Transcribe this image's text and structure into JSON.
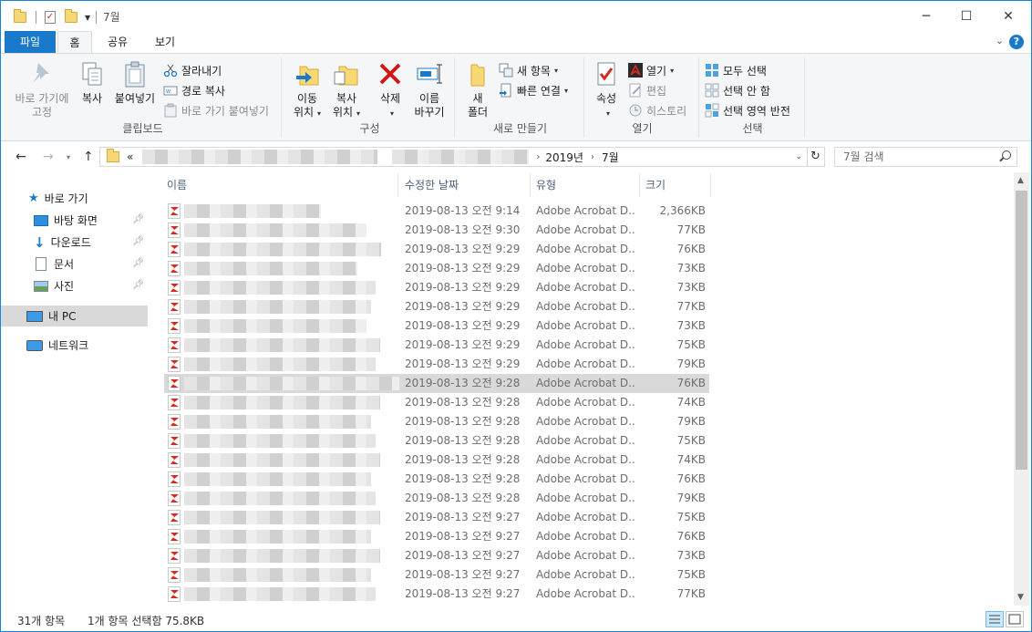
{
  "window": {
    "title": "7월",
    "controls": {
      "minimize": "─",
      "maximize": "☐",
      "close": "✕"
    }
  },
  "tabs": [
    {
      "label": "파일",
      "kind": "file"
    },
    {
      "label": "홈",
      "kind": "active"
    },
    {
      "label": "공유",
      "kind": "normal"
    },
    {
      "label": "보기",
      "kind": "normal"
    }
  ],
  "ribbon": {
    "clipboard": {
      "group": "클립보드",
      "pin": "바로 가기에\n고정",
      "copy": "복사",
      "paste": "붙여넣기",
      "cut": "잘라내기",
      "copy_path": "경로 복사",
      "paste_shortcut": "바로 가기 붙여넣기"
    },
    "organize": {
      "group": "구성",
      "move_to": "이동\n위치",
      "copy_to": "복사\n위치",
      "delete": "삭제",
      "rename": "이름\n바꾸기"
    },
    "new": {
      "group": "새로 만들기",
      "new_folder": "새\n폴더",
      "new_item": "새 항목",
      "easy_access": "빠른 연결"
    },
    "open": {
      "group": "열기",
      "properties": "속성",
      "open": "열기",
      "edit": "편집",
      "history": "히스토리"
    },
    "select": {
      "group": "선택",
      "select_all": "모두 선택",
      "select_none": "선택 안 함",
      "invert": "선택 영역 반전"
    }
  },
  "address": {
    "prefix": "«",
    "crumbs": [
      "2019년",
      "7월"
    ],
    "search_placeholder": "7월 검색"
  },
  "nav": {
    "quick_access": "바로 가기",
    "items": [
      "바탕 화면",
      "다운로드",
      "문서",
      "사진"
    ],
    "this_pc": "내 PC",
    "network": "네트워크"
  },
  "columns": {
    "name": "이름",
    "date": "수정한 날짜",
    "type": "유형",
    "size": "크기"
  },
  "files": [
    {
      "date": "2019-08-13 오전 9:14",
      "type": "Adobe Acrobat D...",
      "size": "2,366KB"
    },
    {
      "date": "2019-08-13 오전 9:30",
      "type": "Adobe Acrobat D...",
      "size": "77KB"
    },
    {
      "date": "2019-08-13 오전 9:29",
      "type": "Adobe Acrobat D...",
      "size": "76KB"
    },
    {
      "date": "2019-08-13 오전 9:29",
      "type": "Adobe Acrobat D...",
      "size": "73KB"
    },
    {
      "date": "2019-08-13 오전 9:29",
      "type": "Adobe Acrobat D...",
      "size": "73KB"
    },
    {
      "date": "2019-08-13 오전 9:29",
      "type": "Adobe Acrobat D...",
      "size": "77KB"
    },
    {
      "date": "2019-08-13 오전 9:29",
      "type": "Adobe Acrobat D...",
      "size": "73KB"
    },
    {
      "date": "2019-08-13 오전 9:29",
      "type": "Adobe Acrobat D...",
      "size": "75KB"
    },
    {
      "date": "2019-08-13 오전 9:29",
      "type": "Adobe Acrobat D...",
      "size": "79KB"
    },
    {
      "date": "2019-08-13 오전 9:28",
      "type": "Adobe Acrobat D...",
      "size": "76KB",
      "selected": true
    },
    {
      "date": "2019-08-13 오전 9:28",
      "type": "Adobe Acrobat D...",
      "size": "74KB"
    },
    {
      "date": "2019-08-13 오전 9:28",
      "type": "Adobe Acrobat D...",
      "size": "79KB"
    },
    {
      "date": "2019-08-13 오전 9:28",
      "type": "Adobe Acrobat D...",
      "size": "75KB"
    },
    {
      "date": "2019-08-13 오전 9:28",
      "type": "Adobe Acrobat D...",
      "size": "74KB"
    },
    {
      "date": "2019-08-13 오전 9:28",
      "type": "Adobe Acrobat D...",
      "size": "76KB"
    },
    {
      "date": "2019-08-13 오전 9:28",
      "type": "Adobe Acrobat D...",
      "size": "79KB"
    },
    {
      "date": "2019-08-13 오전 9:27",
      "type": "Adobe Acrobat D...",
      "size": "75KB"
    },
    {
      "date": "2019-08-13 오전 9:27",
      "type": "Adobe Acrobat D...",
      "size": "76KB"
    },
    {
      "date": "2019-08-13 오전 9:27",
      "type": "Adobe Acrobat D...",
      "size": "73KB"
    },
    {
      "date": "2019-08-13 오전 9:27",
      "type": "Adobe Acrobat D...",
      "size": "75KB"
    },
    {
      "date": "2019-08-13 오전 9:27",
      "type": "Adobe Acrobat D...",
      "size": "77KB"
    }
  ],
  "status": {
    "count": "31개 항목",
    "selection": "1개 항목 선택함 75.8KB"
  },
  "colors": {
    "accent": "#1979ca",
    "selected_row": "#d9d9d9",
    "pdf_red": "#d52b1e",
    "folder": "#f8d775"
  }
}
